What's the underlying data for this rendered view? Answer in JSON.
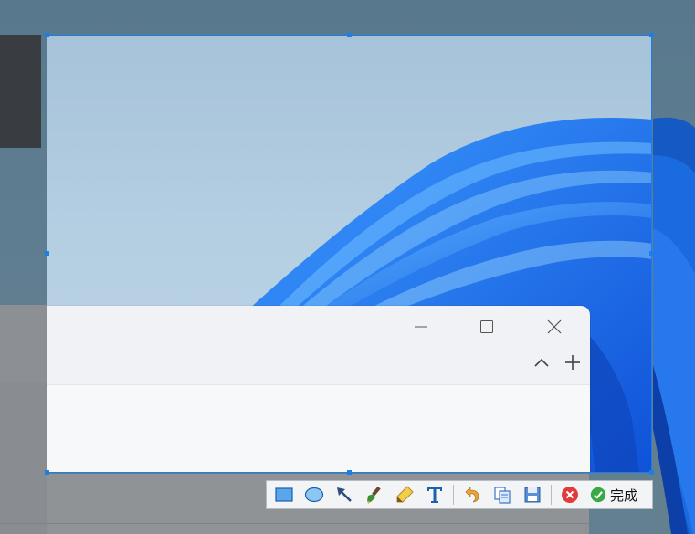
{
  "window": {
    "minimize_icon": "minimize-icon",
    "maximize_icon": "maximize-icon",
    "close_icon": "close-icon"
  },
  "window_toolbar": {
    "collapse_icon": "chevron-up-icon",
    "new_icon": "plus-icon"
  },
  "snip_toolbar": {
    "tools": [
      "rectangle-icon",
      "ellipse-icon",
      "arrow-icon",
      "brush-icon",
      "highlighter-icon",
      "text-icon",
      "undo-icon",
      "copy-icon",
      "save-icon",
      "cancel-icon",
      "done-icon"
    ],
    "done_label": "完成"
  },
  "colors": {
    "selection_border": "#1e7ee6",
    "accent_blue": "#1e7ee6",
    "cancel_red": "#e23b3b",
    "done_green": "#3aa845"
  }
}
